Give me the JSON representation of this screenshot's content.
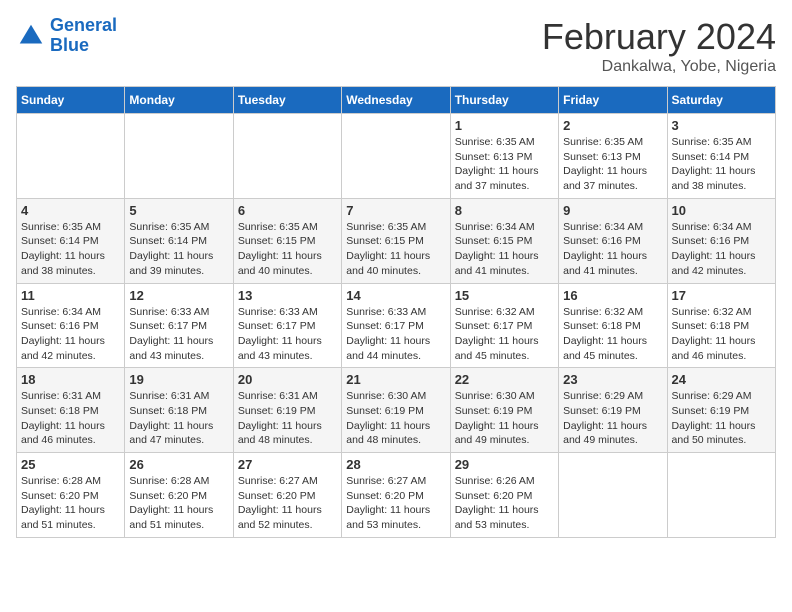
{
  "logo": {
    "text_general": "General",
    "text_blue": "Blue"
  },
  "header": {
    "month": "February 2024",
    "location": "Dankalwa, Yobe, Nigeria"
  },
  "weekdays": [
    "Sunday",
    "Monday",
    "Tuesday",
    "Wednesday",
    "Thursday",
    "Friday",
    "Saturday"
  ],
  "weeks": [
    [
      {
        "day": "",
        "info": ""
      },
      {
        "day": "",
        "info": ""
      },
      {
        "day": "",
        "info": ""
      },
      {
        "day": "",
        "info": ""
      },
      {
        "day": "1",
        "info": "Sunrise: 6:35 AM\nSunset: 6:13 PM\nDaylight: 11 hours\nand 37 minutes."
      },
      {
        "day": "2",
        "info": "Sunrise: 6:35 AM\nSunset: 6:13 PM\nDaylight: 11 hours\nand 37 minutes."
      },
      {
        "day": "3",
        "info": "Sunrise: 6:35 AM\nSunset: 6:14 PM\nDaylight: 11 hours\nand 38 minutes."
      }
    ],
    [
      {
        "day": "4",
        "info": "Sunrise: 6:35 AM\nSunset: 6:14 PM\nDaylight: 11 hours\nand 38 minutes."
      },
      {
        "day": "5",
        "info": "Sunrise: 6:35 AM\nSunset: 6:14 PM\nDaylight: 11 hours\nand 39 minutes."
      },
      {
        "day": "6",
        "info": "Sunrise: 6:35 AM\nSunset: 6:15 PM\nDaylight: 11 hours\nand 40 minutes."
      },
      {
        "day": "7",
        "info": "Sunrise: 6:35 AM\nSunset: 6:15 PM\nDaylight: 11 hours\nand 40 minutes."
      },
      {
        "day": "8",
        "info": "Sunrise: 6:34 AM\nSunset: 6:15 PM\nDaylight: 11 hours\nand 41 minutes."
      },
      {
        "day": "9",
        "info": "Sunrise: 6:34 AM\nSunset: 6:16 PM\nDaylight: 11 hours\nand 41 minutes."
      },
      {
        "day": "10",
        "info": "Sunrise: 6:34 AM\nSunset: 6:16 PM\nDaylight: 11 hours\nand 42 minutes."
      }
    ],
    [
      {
        "day": "11",
        "info": "Sunrise: 6:34 AM\nSunset: 6:16 PM\nDaylight: 11 hours\nand 42 minutes."
      },
      {
        "day": "12",
        "info": "Sunrise: 6:33 AM\nSunset: 6:17 PM\nDaylight: 11 hours\nand 43 minutes."
      },
      {
        "day": "13",
        "info": "Sunrise: 6:33 AM\nSunset: 6:17 PM\nDaylight: 11 hours\nand 43 minutes."
      },
      {
        "day": "14",
        "info": "Sunrise: 6:33 AM\nSunset: 6:17 PM\nDaylight: 11 hours\nand 44 minutes."
      },
      {
        "day": "15",
        "info": "Sunrise: 6:32 AM\nSunset: 6:17 PM\nDaylight: 11 hours\nand 45 minutes."
      },
      {
        "day": "16",
        "info": "Sunrise: 6:32 AM\nSunset: 6:18 PM\nDaylight: 11 hours\nand 45 minutes."
      },
      {
        "day": "17",
        "info": "Sunrise: 6:32 AM\nSunset: 6:18 PM\nDaylight: 11 hours\nand 46 minutes."
      }
    ],
    [
      {
        "day": "18",
        "info": "Sunrise: 6:31 AM\nSunset: 6:18 PM\nDaylight: 11 hours\nand 46 minutes."
      },
      {
        "day": "19",
        "info": "Sunrise: 6:31 AM\nSunset: 6:18 PM\nDaylight: 11 hours\nand 47 minutes."
      },
      {
        "day": "20",
        "info": "Sunrise: 6:31 AM\nSunset: 6:19 PM\nDaylight: 11 hours\nand 48 minutes."
      },
      {
        "day": "21",
        "info": "Sunrise: 6:30 AM\nSunset: 6:19 PM\nDaylight: 11 hours\nand 48 minutes."
      },
      {
        "day": "22",
        "info": "Sunrise: 6:30 AM\nSunset: 6:19 PM\nDaylight: 11 hours\nand 49 minutes."
      },
      {
        "day": "23",
        "info": "Sunrise: 6:29 AM\nSunset: 6:19 PM\nDaylight: 11 hours\nand 49 minutes."
      },
      {
        "day": "24",
        "info": "Sunrise: 6:29 AM\nSunset: 6:19 PM\nDaylight: 11 hours\nand 50 minutes."
      }
    ],
    [
      {
        "day": "25",
        "info": "Sunrise: 6:28 AM\nSunset: 6:20 PM\nDaylight: 11 hours\nand 51 minutes."
      },
      {
        "day": "26",
        "info": "Sunrise: 6:28 AM\nSunset: 6:20 PM\nDaylight: 11 hours\nand 51 minutes."
      },
      {
        "day": "27",
        "info": "Sunrise: 6:27 AM\nSunset: 6:20 PM\nDaylight: 11 hours\nand 52 minutes."
      },
      {
        "day": "28",
        "info": "Sunrise: 6:27 AM\nSunset: 6:20 PM\nDaylight: 11 hours\nand 53 minutes."
      },
      {
        "day": "29",
        "info": "Sunrise: 6:26 AM\nSunset: 6:20 PM\nDaylight: 11 hours\nand 53 minutes."
      },
      {
        "day": "",
        "info": ""
      },
      {
        "day": "",
        "info": ""
      }
    ]
  ]
}
